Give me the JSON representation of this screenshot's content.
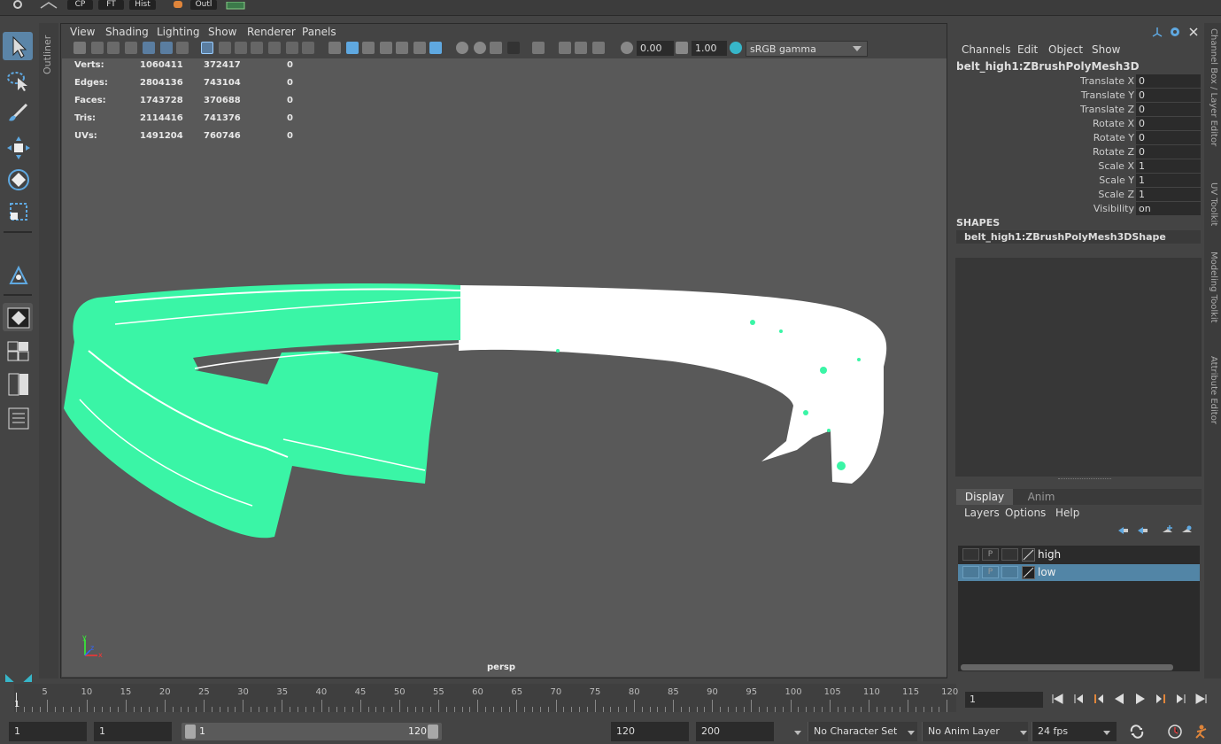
{
  "topbar": {
    "cp": "CP",
    "ft": "FT",
    "hist": "Hist",
    "outl": "Outl"
  },
  "outliner_tab": "Outliner",
  "viewport": {
    "menu": [
      "View",
      "Shading",
      "Lighting",
      "Show",
      "Renderer",
      "Panels"
    ],
    "exposure": "0.00",
    "gamma_value": "1.00",
    "color_space": "sRGB gamma",
    "camera_label": "persp",
    "hud": [
      {
        "label": "Verts:",
        "a": "1060411",
        "b": "372417",
        "c": "0"
      },
      {
        "label": "Edges:",
        "a": "2804136",
        "b": "743104",
        "c": "0"
      },
      {
        "label": "Faces:",
        "a": "1743728",
        "b": "370688",
        "c": "0"
      },
      {
        "label": "Tris:",
        "a": "2114416",
        "b": "741376",
        "c": "0"
      },
      {
        "label": "UVs:",
        "a": "1491204",
        "b": "760746",
        "c": "0"
      }
    ],
    "axis_y": "y",
    "axis_x": "x",
    "axis_z": "z"
  },
  "channel_box": {
    "menu": [
      "Channels",
      "Edit",
      "Object",
      "Show"
    ],
    "object_name": "belt_high1:ZBrushPolyMesh3D",
    "attributes": [
      {
        "label": "Translate X",
        "value": "0"
      },
      {
        "label": "Translate Y",
        "value": "0"
      },
      {
        "label": "Translate Z",
        "value": "0"
      },
      {
        "label": "Rotate X",
        "value": "0"
      },
      {
        "label": "Rotate Y",
        "value": "0"
      },
      {
        "label": "Rotate Z",
        "value": "0"
      },
      {
        "label": "Scale X",
        "value": "1"
      },
      {
        "label": "Scale Y",
        "value": "1"
      },
      {
        "label": "Scale Z",
        "value": "1"
      },
      {
        "label": "Visibility",
        "value": "on"
      }
    ],
    "shapes_header": "SHAPES",
    "shape_name": "belt_high1:ZBrushPolyMesh3DShape"
  },
  "layer_editor": {
    "tabs": [
      "Display",
      "Anim"
    ],
    "menu": [
      "Layers",
      "Options",
      "Help"
    ],
    "layers": [
      {
        "name": "high",
        "p": "P",
        "selected": false
      },
      {
        "name": "low",
        "p": "P",
        "selected": true
      }
    ]
  },
  "side_tabs": [
    "Channel Box / Layer Editor",
    "UV Toolkit",
    "Modeling Toolkit",
    "Attribute Editor"
  ],
  "timeline": {
    "labels": [
      "5",
      "10",
      "15",
      "20",
      "25",
      "30",
      "35",
      "40",
      "45",
      "50",
      "55",
      "60",
      "65",
      "70",
      "75",
      "80",
      "85",
      "90",
      "95",
      "100",
      "105",
      "110",
      "115",
      "120"
    ],
    "playhead_label": "1",
    "current_frame": "1"
  },
  "range": {
    "start": "1",
    "playback_start": "1",
    "slider_start": "1",
    "slider_end": "120",
    "playback_end": "120",
    "end": "200",
    "character_set": "No Character Set",
    "anim_layer": "No Anim Layer",
    "fps": "24 fps"
  },
  "colors": {
    "mesh_green": "#3af5a6",
    "mesh_white": "#ffffff",
    "viewport_bg": "#595959",
    "selection": "#5285a6"
  }
}
